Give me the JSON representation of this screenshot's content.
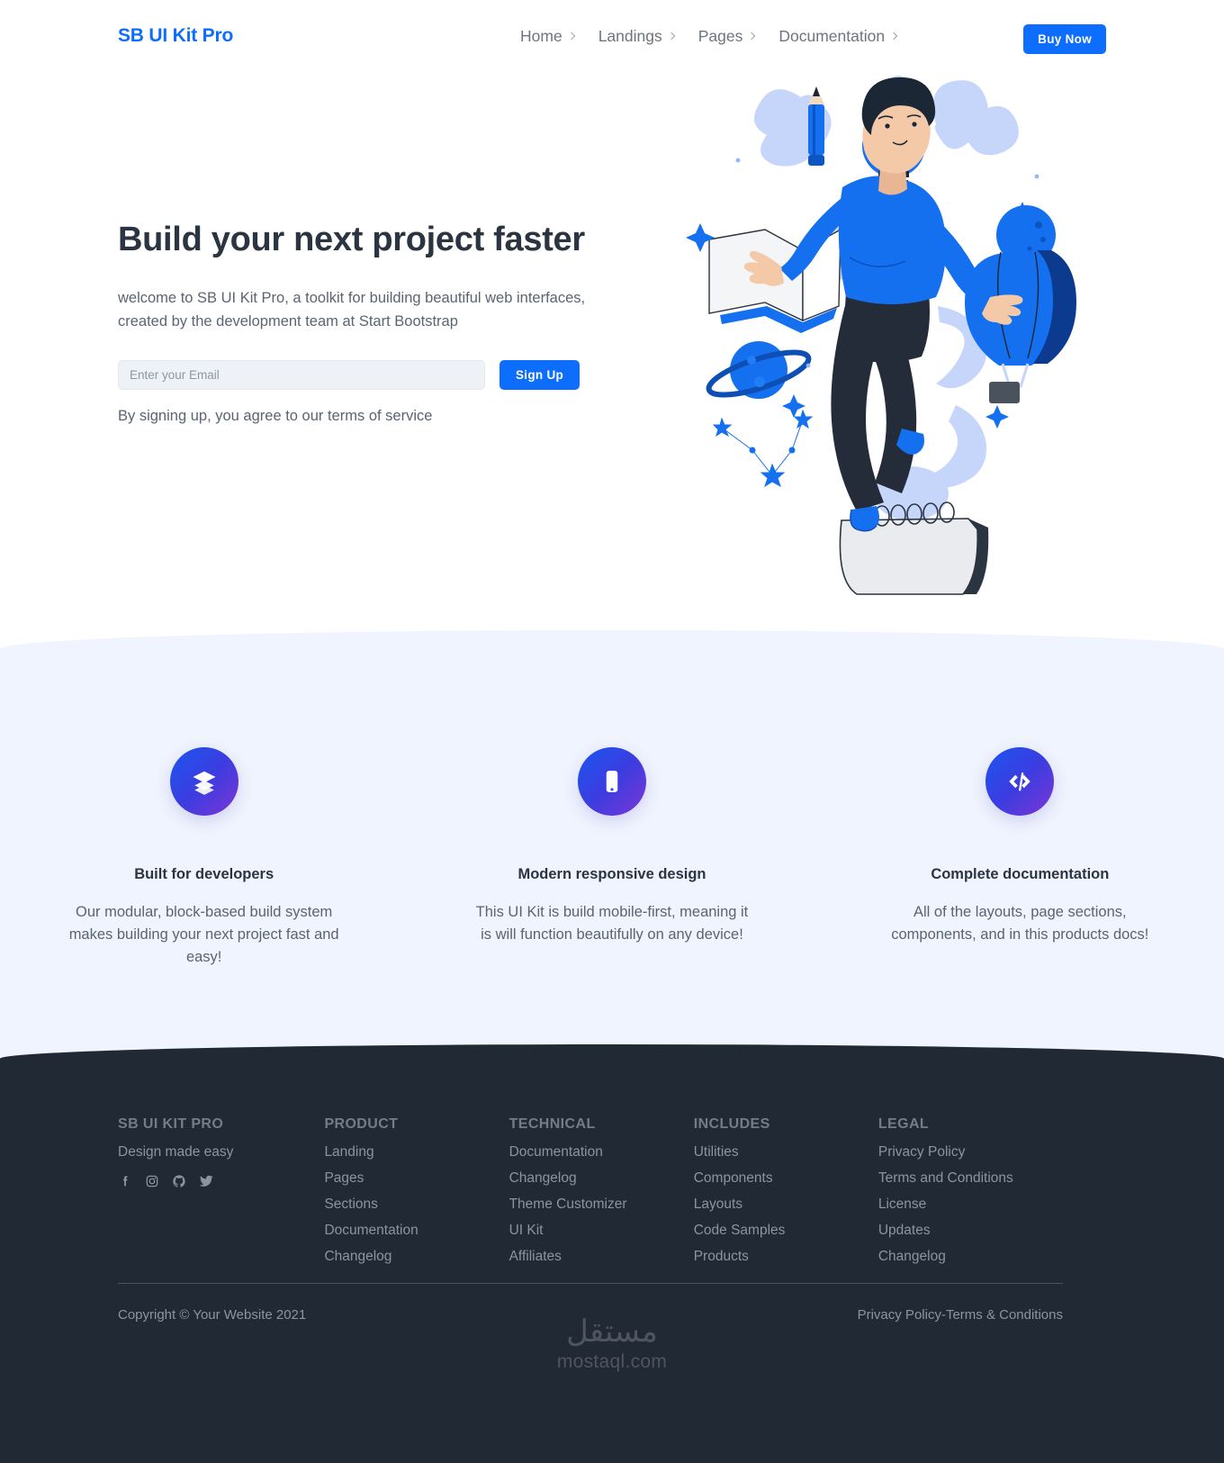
{
  "header": {
    "brand": "SB UI Kit Pro",
    "nav": [
      {
        "label": "Home",
        "icon": "chevron-right-icon"
      },
      {
        "label": "Landings",
        "icon": "chevron-right-icon"
      },
      {
        "label": "Pages",
        "icon": "chevron-right-icon"
      },
      {
        "label": "Documentation",
        "icon": "chevron-right-icon"
      }
    ],
    "cta": "Buy Now",
    "accent_color": "#0d6efd"
  },
  "hero": {
    "title": "Build your next project faster",
    "subtitle": "welcome to SB UI Kit Pro, a toolkit for building beautiful web interfaces, created by the development team at Start Bootstrap",
    "email_placeholder": "Enter your Email",
    "email_value": "",
    "signup_label": "Sign Up",
    "terms_note": "By signing up, you agree to our terms of service",
    "illustration": "man-floating-with-lightbulb-book-planet-illustration"
  },
  "features": {
    "background_color": "#f0f4fe",
    "items": [
      {
        "icon": "layers-stack-icon",
        "title": "Built for developers",
        "description": "Our modular, block-based build system makes building your next project fast and easy!"
      },
      {
        "icon": "mobile-phone-icon",
        "title": "Modern responsive design",
        "description": "This UI Kit is build mobile-first, meaning it is will function beautifully on any device!"
      },
      {
        "icon": "code-brackets-icon",
        "title": "Complete documentation",
        "description": "All of the layouts, page sections, components, and in this products docs!"
      }
    ]
  },
  "footer": {
    "background_color": "#212934",
    "brand_col": {
      "heading": "SB UI KIT PRO",
      "tagline": "Design made easy",
      "socials": [
        {
          "name": "facebook-icon"
        },
        {
          "name": "instagram-icon"
        },
        {
          "name": "github-icon"
        },
        {
          "name": "twitter-icon"
        }
      ]
    },
    "columns": [
      {
        "heading": "PRODUCT",
        "links": [
          "Landing",
          "Pages",
          "Sections",
          "Documentation",
          "Changelog"
        ]
      },
      {
        "heading": "TECHNICAL",
        "links": [
          "Documentation",
          "Changelog",
          "Theme Customizer",
          "UI Kit",
          "Affiliates"
        ]
      },
      {
        "heading": "INCLUDES",
        "links": [
          "Utilities",
          "Components",
          "Layouts",
          "Code Samples",
          "Products"
        ]
      },
      {
        "heading": "LEGAL",
        "links": [
          "Privacy Policy",
          "Terms and Conditions",
          "License",
          "Updates",
          "Changelog"
        ]
      }
    ],
    "copyright": "Copyright © Your Website 2021",
    "terms_link": "Privacy Policy-Terms & Conditions"
  },
  "watermark": {
    "arabic": "مستقل",
    "latin": "mostaql.com"
  }
}
